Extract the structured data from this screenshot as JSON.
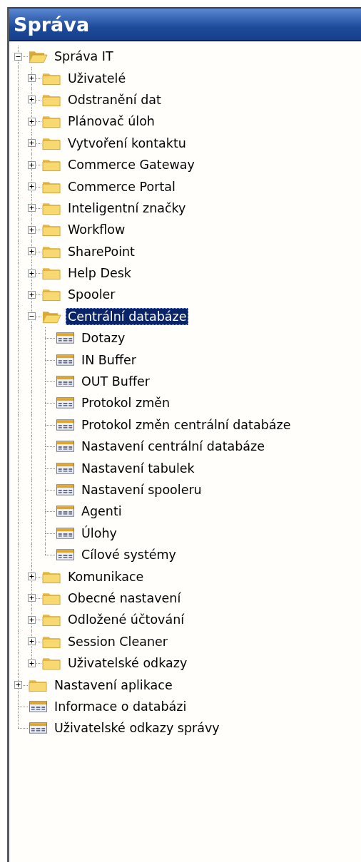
{
  "panel": {
    "title": "Správa"
  },
  "tree": [
    {
      "label": "Správa IT",
      "kind": "folder",
      "expanded": true,
      "selected": false,
      "children": [
        {
          "label": "Uživatelé",
          "kind": "folder",
          "expanded": false,
          "selected": false
        },
        {
          "label": "Odstranění dat",
          "kind": "folder",
          "expanded": false,
          "selected": false
        },
        {
          "label": "Plánovač úloh",
          "kind": "folder",
          "expanded": false,
          "selected": false
        },
        {
          "label": "Vytvoření kontaktu",
          "kind": "folder",
          "expanded": false,
          "selected": false
        },
        {
          "label": "Commerce Gateway",
          "kind": "folder",
          "expanded": false,
          "selected": false
        },
        {
          "label": "Commerce Portal",
          "kind": "folder",
          "expanded": false,
          "selected": false
        },
        {
          "label": "Inteligentní značky",
          "kind": "folder",
          "expanded": false,
          "selected": false
        },
        {
          "label": "Workflow",
          "kind": "folder",
          "expanded": false,
          "selected": false
        },
        {
          "label": "SharePoint",
          "kind": "folder",
          "expanded": false,
          "selected": false
        },
        {
          "label": "Help Desk",
          "kind": "folder",
          "expanded": false,
          "selected": false
        },
        {
          "label": "Spooler",
          "kind": "folder",
          "expanded": false,
          "selected": false
        },
        {
          "label": "Centrální databáze",
          "kind": "folder",
          "expanded": true,
          "selected": true,
          "children": [
            {
              "label": "Dotazy",
              "kind": "table",
              "selected": false
            },
            {
              "label": "IN Buffer",
              "kind": "table",
              "selected": false
            },
            {
              "label": "OUT Buffer",
              "kind": "table",
              "selected": false
            },
            {
              "label": "Protokol změn",
              "kind": "table",
              "selected": false
            },
            {
              "label": "Protokol změn centrální databáze",
              "kind": "table",
              "selected": false
            },
            {
              "label": "Nastavení centrální databáze",
              "kind": "table",
              "selected": false
            },
            {
              "label": "Nastavení tabulek",
              "kind": "table",
              "selected": false
            },
            {
              "label": "Nastavení spooleru",
              "kind": "table",
              "selected": false
            },
            {
              "label": "Agenti",
              "kind": "table",
              "selected": false
            },
            {
              "label": "Úlohy",
              "kind": "table",
              "selected": false
            },
            {
              "label": "Cílové systémy",
              "kind": "table",
              "selected": false
            }
          ]
        },
        {
          "label": "Komunikace",
          "kind": "folder",
          "expanded": false,
          "selected": false
        },
        {
          "label": "Obecné nastavení",
          "kind": "folder",
          "expanded": false,
          "selected": false
        },
        {
          "label": "Odložené účtování",
          "kind": "folder",
          "expanded": false,
          "selected": false
        },
        {
          "label": "Session Cleaner",
          "kind": "folder",
          "expanded": false,
          "selected": false
        },
        {
          "label": "Uživatelské odkazy",
          "kind": "folder",
          "expanded": false,
          "selected": false
        }
      ]
    },
    {
      "label": "Nastavení aplikace",
      "kind": "folder",
      "expanded": false,
      "selected": false
    },
    {
      "label": "Informace o databázi",
      "kind": "table",
      "selected": false
    },
    {
      "label": "Uživatelské odkazy správy",
      "kind": "table",
      "selected": false
    }
  ]
}
